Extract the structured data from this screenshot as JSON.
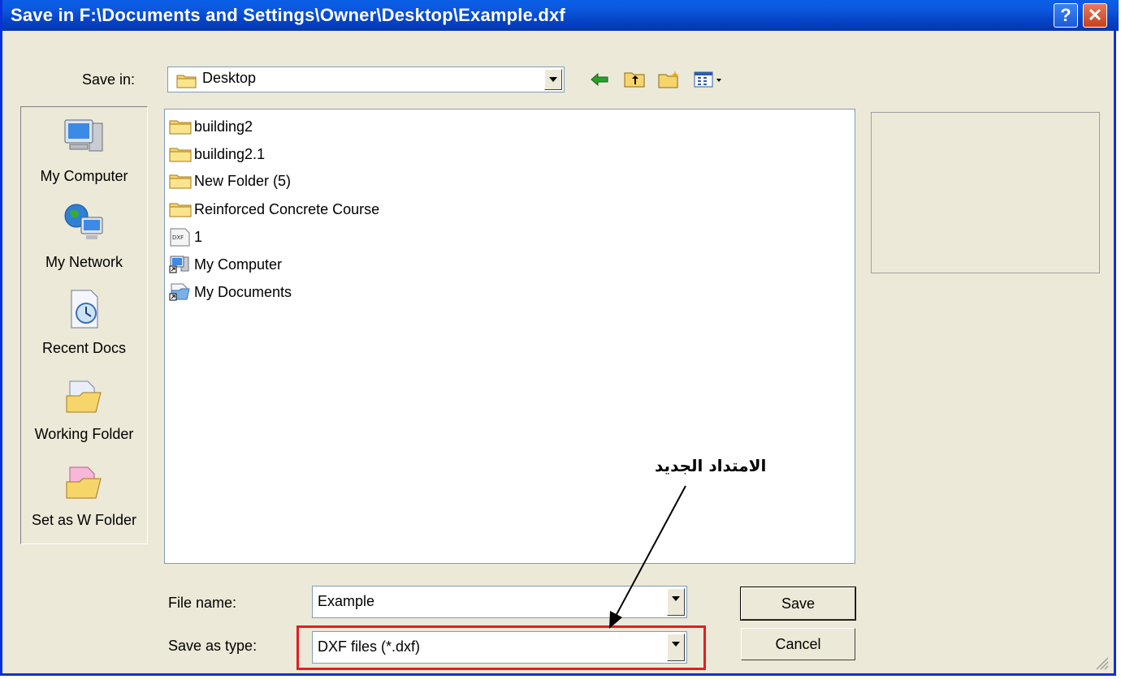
{
  "window": {
    "title": "Save in F:\\Documents and Settings\\Owner\\Desktop\\Example.dxf",
    "help_label": "?",
    "close_label": "✕"
  },
  "save_in": {
    "label": "Save in:",
    "value": "Desktop",
    "icon": "folder-icon"
  },
  "toolbar": {
    "icons": [
      "back-arrow-icon",
      "up-folder-icon",
      "new-folder-icon",
      "view-menu-icon"
    ]
  },
  "places": [
    {
      "label": "My Computer",
      "icon": "my-computer-icon"
    },
    {
      "label": "My Network",
      "icon": "my-network-icon"
    },
    {
      "label": "Recent Docs",
      "icon": "recent-docs-icon"
    },
    {
      "label": "Working Folder",
      "icon": "working-folder-icon"
    },
    {
      "label": "Set as W Folder",
      "icon": "set-working-folder-icon"
    }
  ],
  "files": [
    {
      "name": "building2",
      "icon": "folder-icon"
    },
    {
      "name": "building2.1",
      "icon": "folder-icon"
    },
    {
      "name": "New Folder (5)",
      "icon": "folder-icon"
    },
    {
      "name": "Reinforced Concrete Course",
      "icon": "folder-icon"
    },
    {
      "name": "1",
      "icon": "dxf-file-icon"
    },
    {
      "name": "My Computer",
      "icon": "my-computer-shortcut-icon"
    },
    {
      "name": "My Documents",
      "icon": "my-documents-shortcut-icon"
    }
  ],
  "dxf_icon_text": "DXF",
  "form": {
    "file_name_label": "File name:",
    "file_name_value": "Example",
    "save_type_label": "Save as type:",
    "save_type_value": "DXF files (*.dxf)"
  },
  "buttons": {
    "save": "Save",
    "cancel": "Cancel"
  },
  "annotation": {
    "text": "الامتداد الجديد",
    "highlight_color": "#e02020"
  }
}
